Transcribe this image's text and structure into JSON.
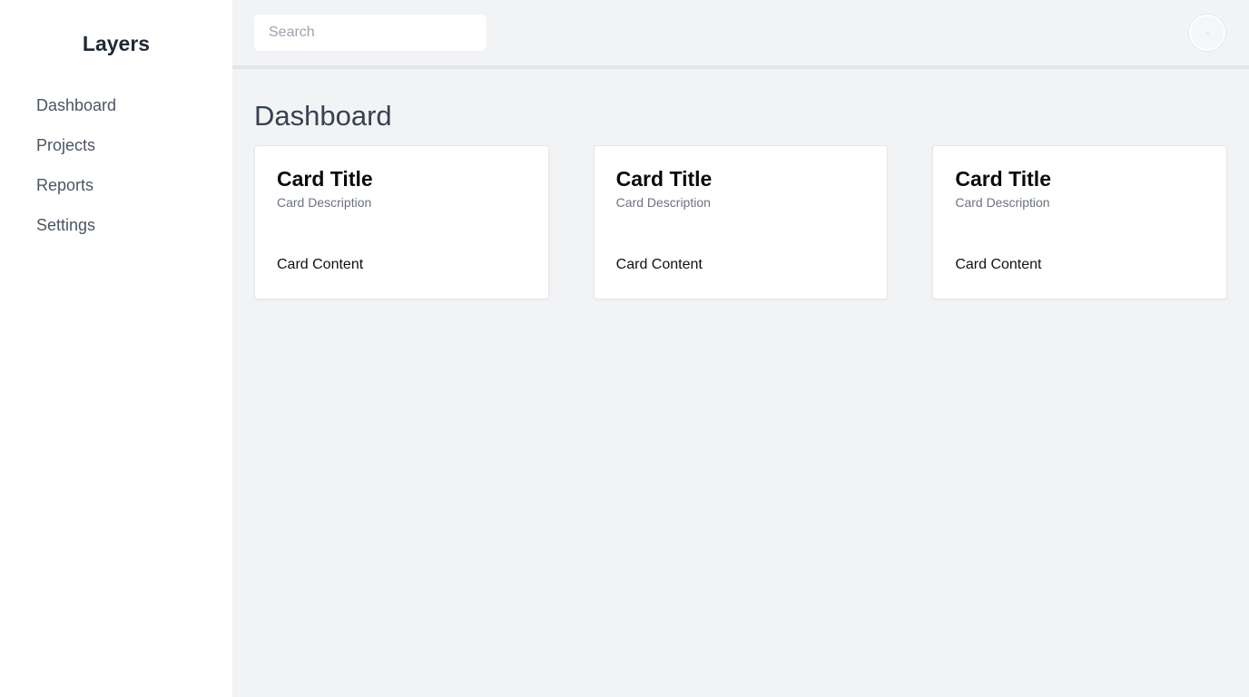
{
  "sidebar": {
    "title": "Layers",
    "items": [
      {
        "label": "Dashboard"
      },
      {
        "label": "Projects"
      },
      {
        "label": "Reports"
      },
      {
        "label": "Settings"
      }
    ]
  },
  "header": {
    "search": {
      "placeholder": "Search",
      "value": ""
    },
    "avatar_icon": "avatar-icon"
  },
  "main": {
    "title": "Dashboard",
    "cards": [
      {
        "title": "Card Title",
        "description": "Card Description",
        "content": "Card Content"
      },
      {
        "title": "Card Title",
        "description": "Card Description",
        "content": "Card Content"
      },
      {
        "title": "Card Title",
        "description": "Card Description",
        "content": "Card Content"
      }
    ]
  }
}
